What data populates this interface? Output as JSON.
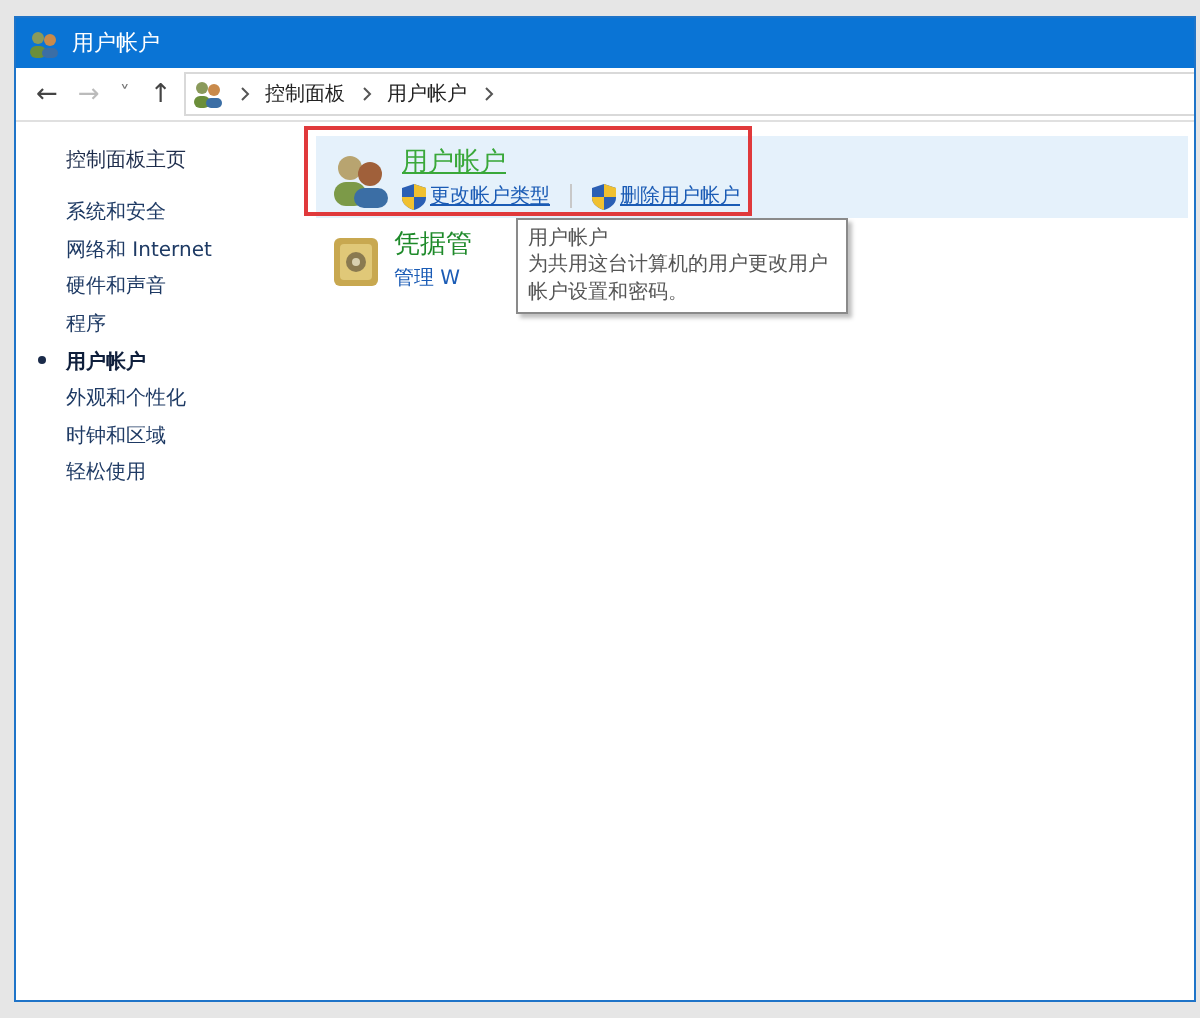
{
  "window": {
    "title": "用户帐户"
  },
  "nav": {
    "back": "←",
    "forward": "→",
    "recent": "˅",
    "up": "↑",
    "path": [
      {
        "label": "控制面板"
      },
      {
        "label": "用户帐户"
      }
    ]
  },
  "sidebar": {
    "home": "控制面板主页",
    "items": [
      {
        "label": "系统和安全",
        "selected": false
      },
      {
        "label": "网络和 Internet",
        "selected": false
      },
      {
        "label": "硬件和声音",
        "selected": false
      },
      {
        "label": "程序",
        "selected": false
      },
      {
        "label": "用户帐户",
        "selected": true
      },
      {
        "label": "外观和个性化",
        "selected": false
      },
      {
        "label": "时钟和区域",
        "selected": false
      },
      {
        "label": "轻松使用",
        "selected": false
      }
    ]
  },
  "categories": [
    {
      "title": "用户帐户",
      "kind": "users",
      "hovered": true,
      "highlighted": true,
      "links": [
        {
          "label": "更改帐户类型",
          "shield": true
        },
        {
          "label": "删除用户帐户",
          "shield": true
        }
      ]
    },
    {
      "title": "凭据管",
      "kind": "vault",
      "hovered": false,
      "highlighted": false,
      "links": [
        {
          "label": "管理 W",
          "shield": false
        }
      ]
    }
  ],
  "tooltip": {
    "title": "用户帐户",
    "text": "为共用这台计算机的用户更改用户帐户设置和密码。"
  }
}
